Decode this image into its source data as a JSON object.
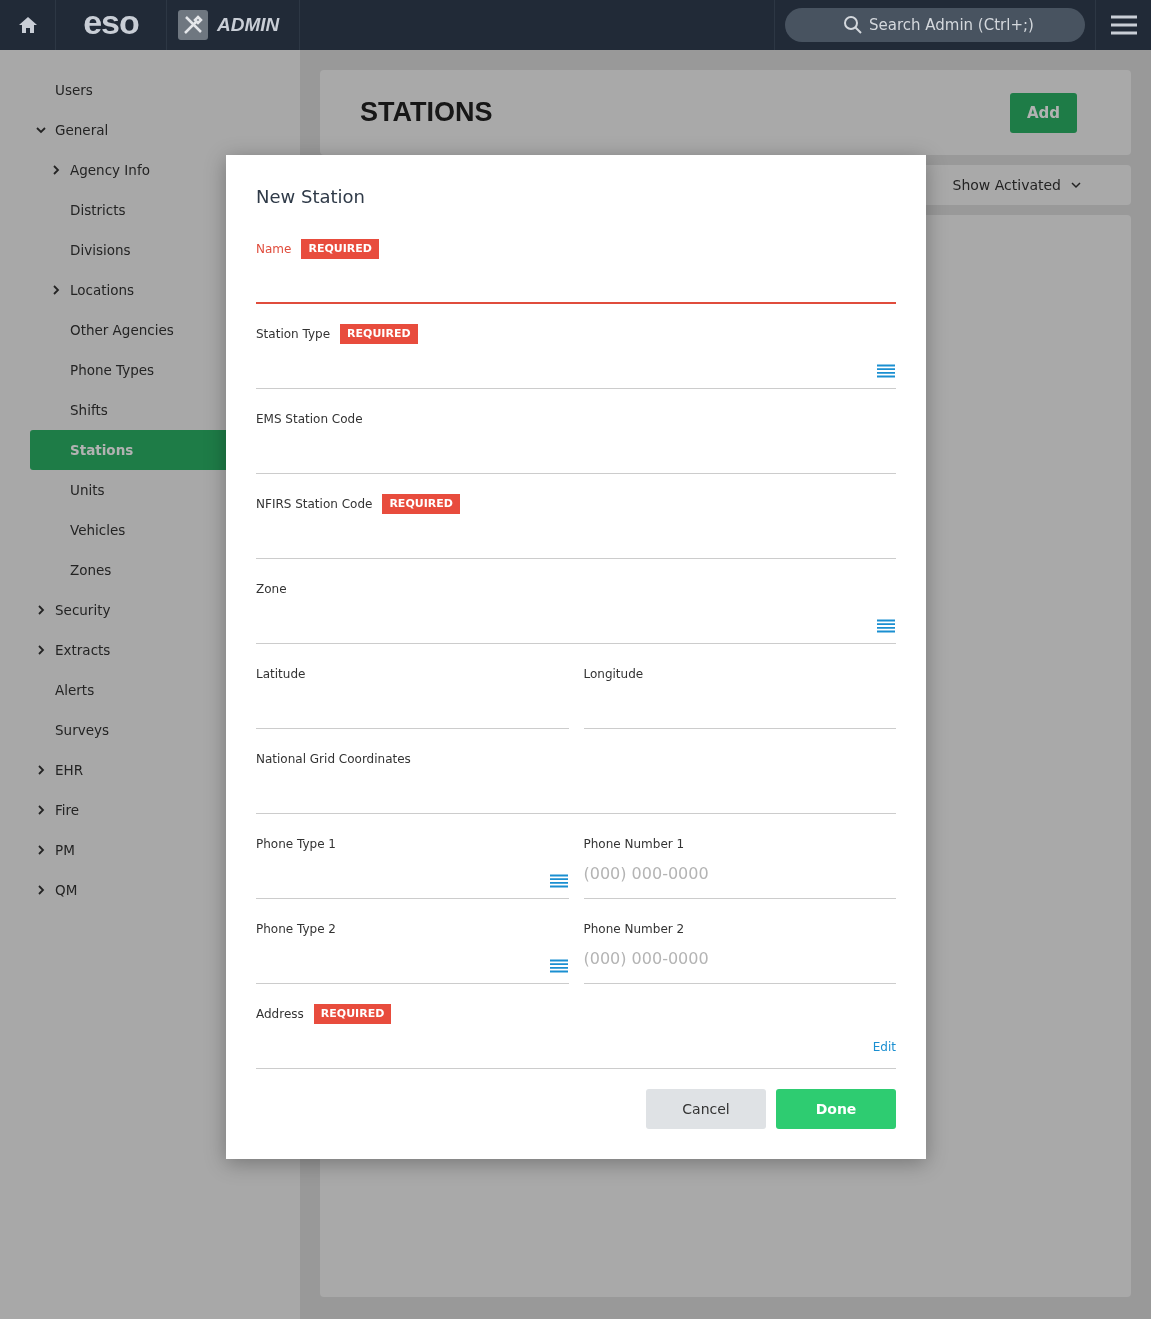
{
  "header": {
    "logo": "eso",
    "section": "ADMIN",
    "search": {
      "placeholder": "Search Admin (Ctrl+;)"
    }
  },
  "sidebar": {
    "items": [
      {
        "label": "Users",
        "selected": false
      },
      {
        "label": "General",
        "selected": false,
        "expanded": true,
        "children": [
          {
            "label": "Agency Info",
            "selected": false,
            "expanded": false
          },
          {
            "label": "Districts",
            "selected": false
          },
          {
            "label": "Divisions",
            "selected": false
          },
          {
            "label": "Locations",
            "selected": false,
            "expanded": false
          },
          {
            "label": "Other Agencies",
            "selected": false
          },
          {
            "label": "Phone Types",
            "selected": false
          },
          {
            "label": "Shifts",
            "selected": false
          },
          {
            "label": "Stations",
            "selected": true
          },
          {
            "label": "Units",
            "selected": false
          },
          {
            "label": "Vehicles",
            "selected": false
          },
          {
            "label": "Zones",
            "selected": false
          }
        ]
      },
      {
        "label": "Security",
        "selected": false,
        "expanded": false
      },
      {
        "label": "Extracts",
        "selected": false,
        "expanded": false
      },
      {
        "label": "Alerts",
        "selected": false
      },
      {
        "label": "Surveys",
        "selected": false
      },
      {
        "label": "EHR",
        "selected": false,
        "expanded": false
      },
      {
        "label": "Fire",
        "selected": false,
        "expanded": false
      },
      {
        "label": "PM",
        "selected": false,
        "expanded": false
      },
      {
        "label": "QM",
        "selected": false,
        "expanded": false
      }
    ]
  },
  "page": {
    "title": "STATIONS",
    "add_button": "Add",
    "filter": "Show Activated"
  },
  "dialog": {
    "title": "New Station",
    "rows": [
      {
        "fields": [
          {
            "label": "Name",
            "kind": "text",
            "badge": "REQUIRED",
            "error": true
          }
        ]
      },
      {
        "fields": [
          {
            "label": "Station Type",
            "kind": "select",
            "badge": "REQUIRED",
            "error": false
          }
        ]
      },
      {
        "fields": [
          {
            "label": "EMS Station Code",
            "kind": "text",
            "error": false
          }
        ]
      },
      {
        "fields": [
          {
            "label": "NFIRS Station Code",
            "kind": "text",
            "badge": "REQUIRED",
            "error": false
          }
        ]
      },
      {
        "fields": [
          {
            "label": "Zone",
            "kind": "select",
            "error": false
          }
        ]
      },
      {
        "fields": [
          {
            "label": "Latitude",
            "kind": "text",
            "error": false
          },
          {
            "label": "Longitude",
            "kind": "text",
            "error": false
          }
        ]
      },
      {
        "fields": [
          {
            "label": "National Grid Coordinates",
            "kind": "text",
            "error": false
          }
        ]
      },
      {
        "fields": [
          {
            "label": "Phone Type 1",
            "kind": "select",
            "error": false
          },
          {
            "label": "Phone Number 1",
            "kind": "phone",
            "placeholder": "(000) 000-0000",
            "error": false
          }
        ]
      },
      {
        "fields": [
          {
            "label": "Phone Type 2",
            "kind": "select",
            "error": false
          },
          {
            "label": "Phone Number 2",
            "kind": "phone",
            "placeholder": "(000) 000-0000",
            "error": false
          }
        ]
      },
      {
        "fields": [
          {
            "label": "Address",
            "kind": "link",
            "action": "Edit",
            "badge": "REQUIRED",
            "error": false
          }
        ]
      }
    ],
    "cancel": "Cancel",
    "done": "Done"
  }
}
